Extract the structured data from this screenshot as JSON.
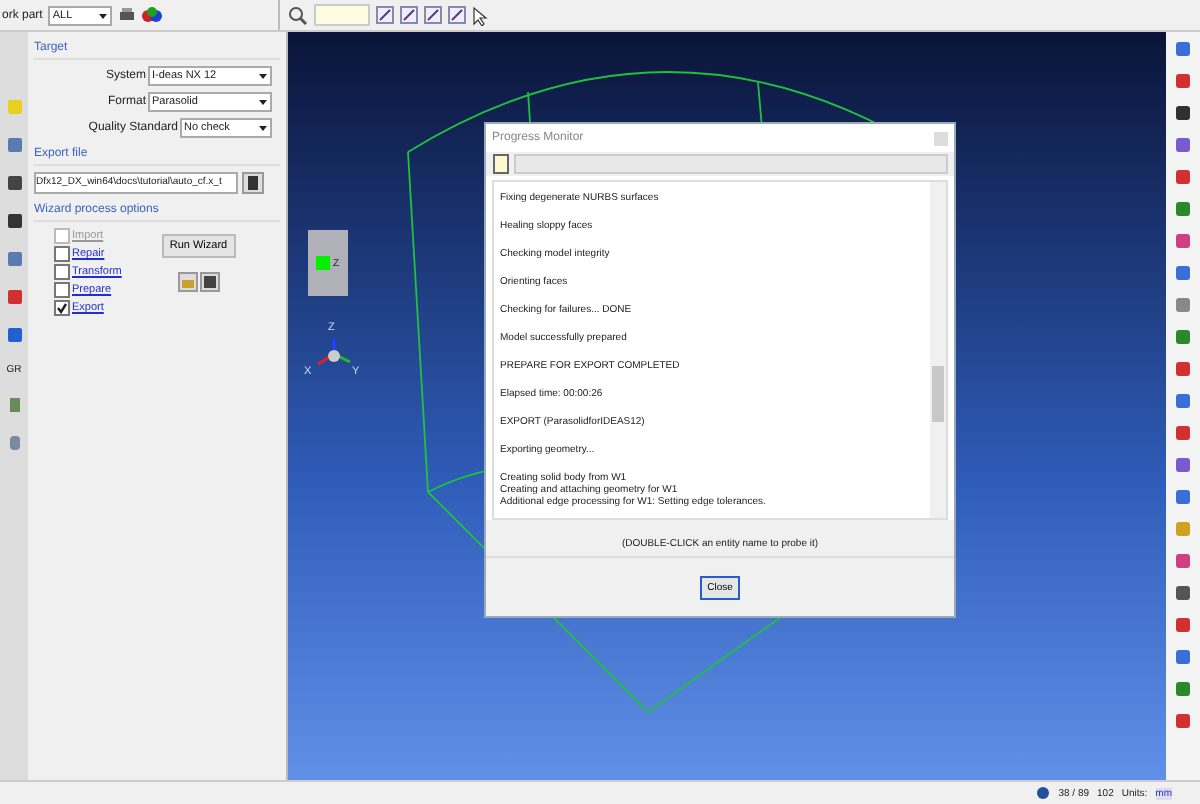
{
  "toolbar": {
    "part_label": "ork part",
    "part_value": "ALL"
  },
  "left_strip": {
    "text_button": "GR"
  },
  "panel": {
    "target": {
      "title": "Target",
      "rows": [
        {
          "label": "System",
          "value": "I-deas NX 12"
        },
        {
          "label": "Format",
          "value": "Parasolid"
        },
        {
          "label": "Quality Standard",
          "value": "No check"
        }
      ]
    },
    "export_file": {
      "title": "Export file",
      "path": "Dfx12_DX_win64\\docs\\tutorial\\auto_cf.x_t"
    },
    "wizard": {
      "title": "Wizard process options",
      "steps": [
        {
          "label": "Import",
          "checked": false,
          "disabled": true
        },
        {
          "label": "Repair",
          "checked": false,
          "disabled": false
        },
        {
          "label": "Transform",
          "checked": false,
          "disabled": false
        },
        {
          "label": "Prepare",
          "checked": false,
          "disabled": false
        },
        {
          "label": "Export",
          "checked": true,
          "disabled": false
        }
      ],
      "run_button": "Run Wizard"
    }
  },
  "viewport": {
    "nav_cube_label": "Z",
    "axes": {
      "z": "Z",
      "x": "X",
      "y": "Y"
    }
  },
  "dialog": {
    "title": "Progress Monitor",
    "progress": {
      "level": 0
    },
    "log": [
      "Fixing degenerate NURBS surfaces",
      "Healing sloppy faces",
      "Checking model integrity",
      "Orienting faces",
      "Checking for failures... DONE",
      "Model successfully prepared",
      "PREPARE FOR EXPORT COMPLETED",
      "Elapsed time: 00:00:26",
      "EXPORT (ParasolidforIDEAS12)",
      "Exporting geometry..."
    ],
    "log_detail": [
      "Creating solid body from W1",
      "Creating and attaching geometry for W1",
      "Additional edge processing for W1: Setting edge tolerances."
    ],
    "hint": "(DOUBLE-CLICK an entity name to probe it)",
    "close_button": "Close"
  },
  "status_bar": {
    "count": "38 / 89",
    "number": "102",
    "units_label": "Units:",
    "units_value": "mm"
  }
}
